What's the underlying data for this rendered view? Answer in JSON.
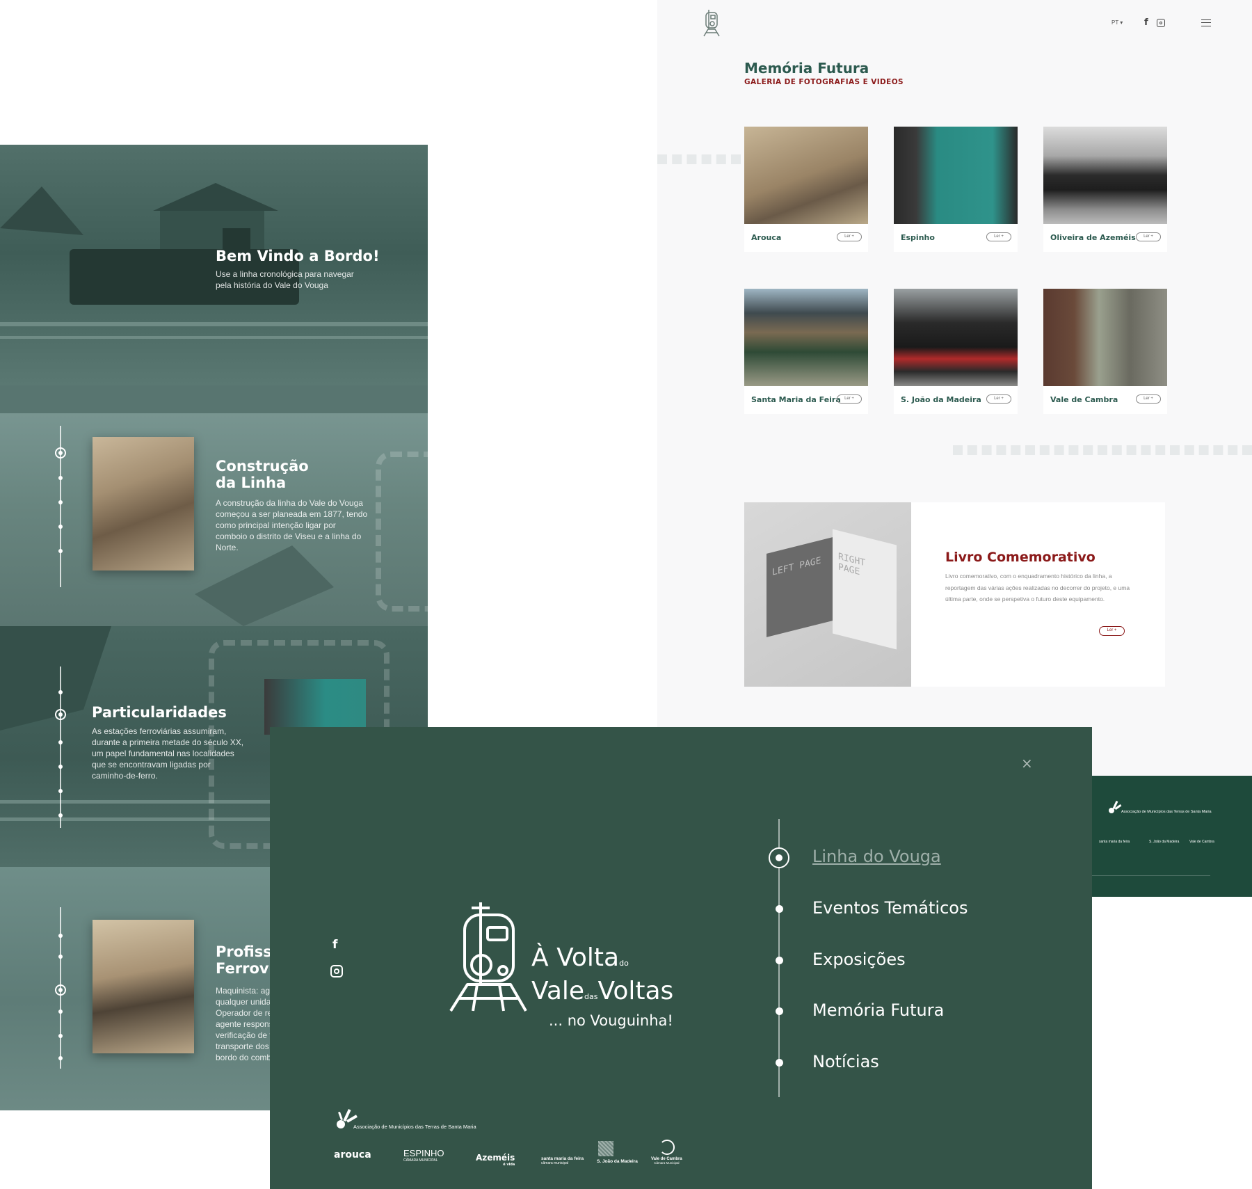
{
  "timeline": {
    "welcome": {
      "title": "Bem Vindo a Bordo!",
      "text": "Use a linha cronológica para navegar pela história do Vale do Vouga"
    },
    "sections": [
      {
        "title": "Construção da Linha",
        "text": "A construção da linha do Vale do Vouga começou a ser planeada em 1877, tendo como principal intenção ligar por comboio o distrito de Viseu e a linha do Norte."
      },
      {
        "title": "Particularidades",
        "text": "As estações ferroviárias assumiram, durante a primeira metade do século XX, um papel fundamental nas localidades que se encontravam ligadas por caminho-de-ferro."
      },
      {
        "title": "Profissões Ferroviárias",
        "text": "Maquinista: agente que conduz qualquer unidade motora. Operador de revisão e venda: agente responsável pela venda e verificação de títulos de transporte dos passageiros a bordo do comboio."
      }
    ]
  },
  "gallery": {
    "lang": "PT",
    "social": [
      "facebook-icon",
      "instagram-icon"
    ],
    "title": "Memória Futura",
    "subtitle": "GALERIA DE FOTOGRAFIAS E VIDEOS",
    "read_more": "Ler +",
    "cards": [
      {
        "caption": "Arouca",
        "tone": "#a08a6c"
      },
      {
        "caption": "Espinho",
        "tone": "#2e8e86"
      },
      {
        "caption": "Oliveira de Azeméis",
        "tone": "#5a5a5a"
      },
      {
        "caption": "Santa Maria da Feira",
        "tone": "#4a5a55"
      },
      {
        "caption": "S. João da Madeira",
        "tone": "#6a2a25"
      },
      {
        "caption": "Vale de Cambra",
        "tone": "#7a7e72"
      }
    ],
    "book": {
      "title": "Livro Comemorativo",
      "text": "Livro comemorativo, com o enquadramento histórico da linha, a reportagem das várias ações realizadas no decorrer do projeto, e uma última parte, onde se perspetiva o futuro deste equipamento.",
      "page_left": "LEFT PAGE",
      "page_right": "RIGHT PAGE"
    }
  },
  "footer_strip": {
    "assoc": "Associação de Municípios das Terras de Santa Maria",
    "logos": [
      "santa maria da feira",
      "S. João da Madeira",
      "Vale de Cambra"
    ]
  },
  "menu": {
    "brand": {
      "line1": "À Volta",
      "small1": "do",
      "line2a": "Vale",
      "small2": "das",
      "line2b": "Voltas",
      "line3": "... no Vouguinha!"
    },
    "items": [
      "Linha do Vouga",
      "Eventos Temáticos",
      "Exposições",
      "Memória Futura",
      "Notícias"
    ],
    "active_index": 0,
    "assoc": "Associação de Municípios das Terras de Santa Maria",
    "partners": [
      "arouca",
      "ESPINHO",
      "Azeméis",
      "santa maria da feira",
      "S. João da Madeira",
      "Vale de Cambra"
    ],
    "partner_subs": [
      "CÂMARA MUNICIPAL",
      "é vida",
      "câmara municipal",
      "Câmara Municipal"
    ]
  },
  "colors": {
    "menu_bg": "#345448",
    "accent_green": "#2c5a4f",
    "accent_red": "#8b1a1a",
    "footer_green": "#1e4a3b"
  }
}
